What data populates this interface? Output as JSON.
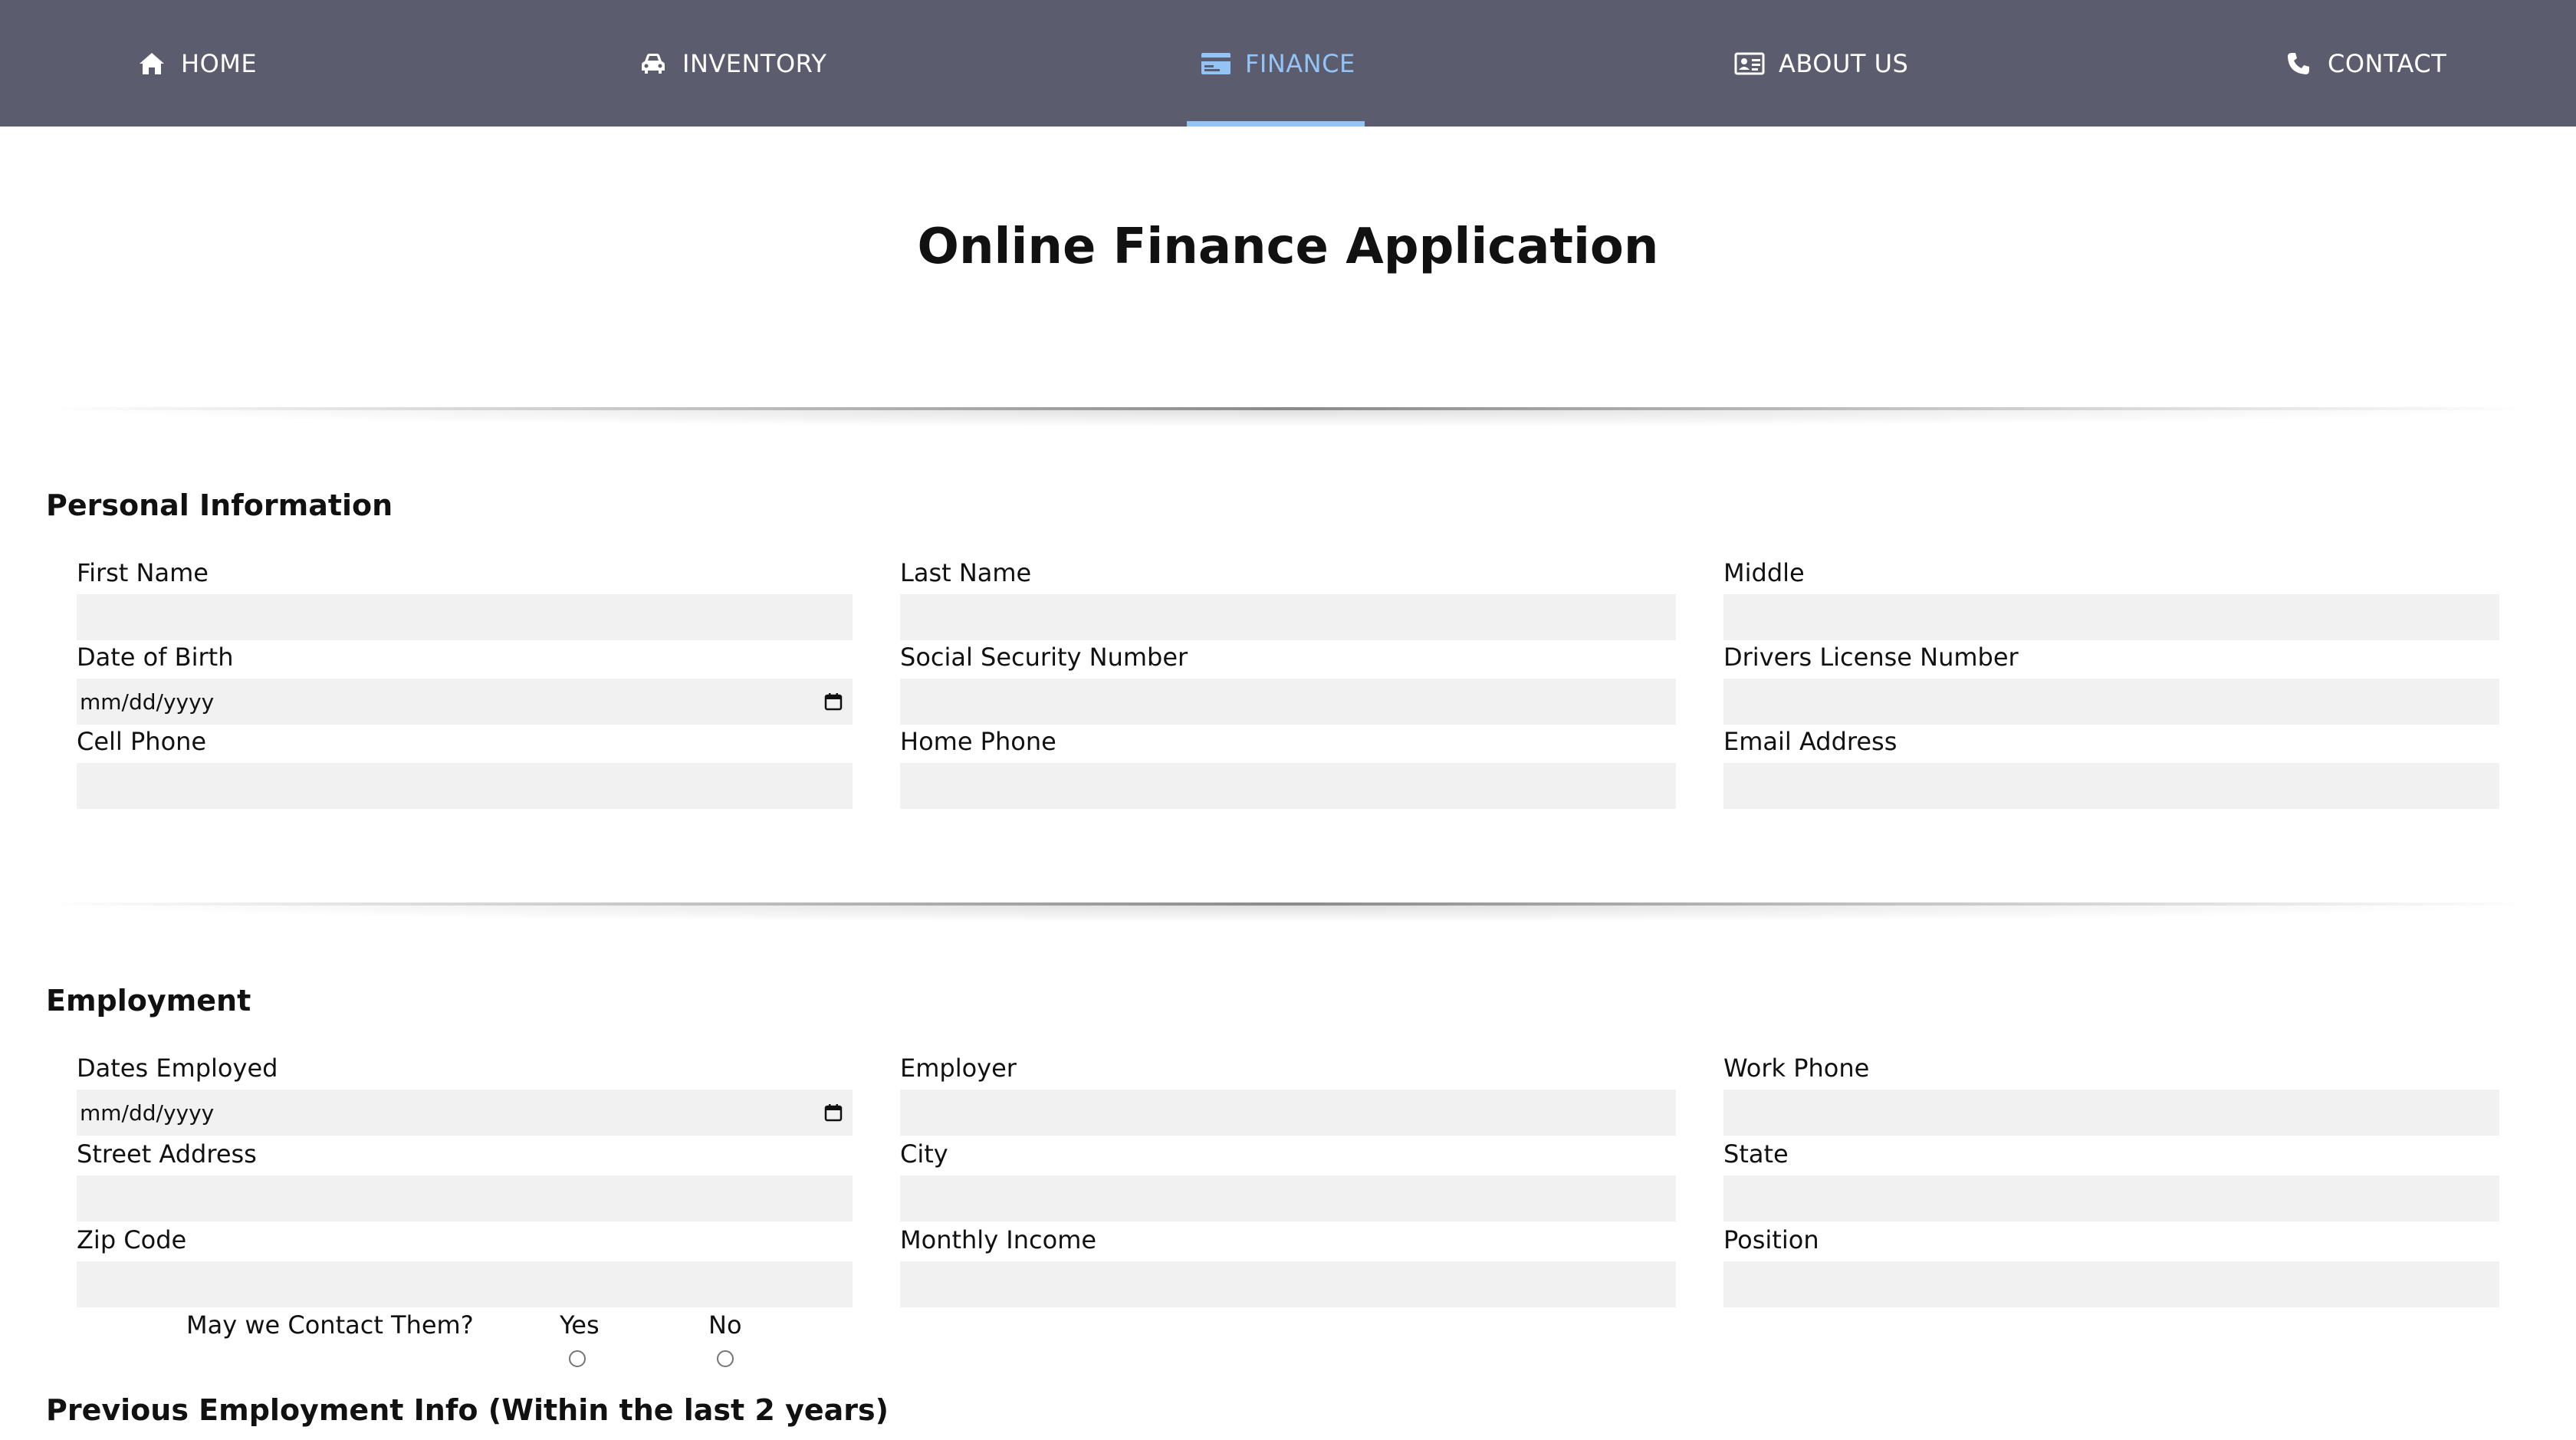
{
  "nav": {
    "items": [
      {
        "label": "HOME",
        "icon": "home-icon"
      },
      {
        "label": "INVENTORY",
        "icon": "car-icon"
      },
      {
        "label": "FINANCE",
        "icon": "credit-card-icon",
        "active": true
      },
      {
        "label": "ABOUT US",
        "icon": "id-card-icon"
      },
      {
        "label": "CONTACT",
        "icon": "phone-icon"
      }
    ],
    "background": "#5b5d6e",
    "active_color": "#93c4f5"
  },
  "page_title": "Online Finance Application",
  "personal": {
    "title": "Personal Information",
    "fields": {
      "first_name": {
        "label": "First Name",
        "value": ""
      },
      "last_name": {
        "label": "Last Name",
        "value": ""
      },
      "middle": {
        "label": "Middle",
        "value": ""
      },
      "dob": {
        "label": "Date of Birth",
        "placeholder": "mm/dd/yyyy"
      },
      "ssn": {
        "label": "Social Security Number",
        "value": ""
      },
      "license": {
        "label": "Drivers License Number",
        "value": ""
      },
      "cell": {
        "label": "Cell Phone",
        "value": ""
      },
      "home_phone": {
        "label": "Home Phone",
        "value": ""
      },
      "email": {
        "label": "Email Address",
        "value": ""
      }
    }
  },
  "employment": {
    "title": "Employment",
    "fields": {
      "dates": {
        "label": "Dates Employed",
        "placeholder": "mm/dd/yyyy"
      },
      "employer": {
        "label": "Employer",
        "value": ""
      },
      "work_phone": {
        "label": "Work Phone",
        "value": ""
      },
      "street": {
        "label": "Street Address",
        "value": ""
      },
      "city": {
        "label": "City",
        "value": ""
      },
      "state": {
        "label": "State",
        "value": ""
      },
      "zip": {
        "label": "Zip Code",
        "value": ""
      },
      "income": {
        "label": "Monthly Income",
        "value": ""
      },
      "position": {
        "label": "Position",
        "value": ""
      }
    },
    "contact_question": "May we Contact Them?",
    "yes_label": "Yes",
    "no_label": "No"
  },
  "previous_employment": {
    "title": "Previous Employment Info (Within the last 2 years)"
  }
}
